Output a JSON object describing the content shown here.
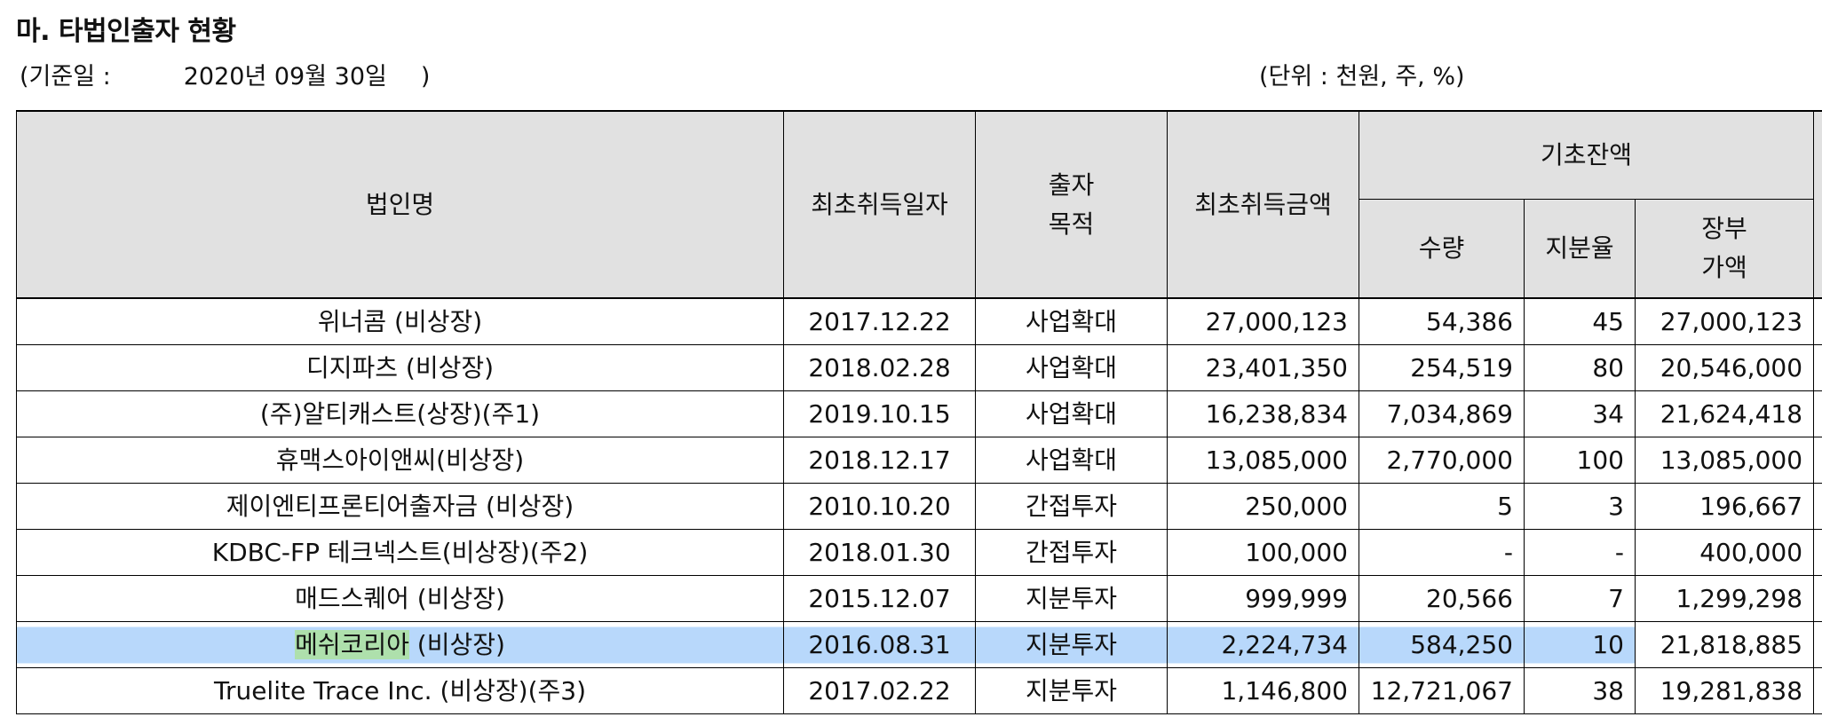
{
  "section_title": "마. 타법인출자 현황",
  "basis_label": "(기준일 :",
  "basis_date": "2020년 09월 30일",
  "basis_close": ")",
  "unit_label": "(단위 : 천원, 주, %)",
  "headers": {
    "corp_name": "법인명",
    "first_acq_date": "최초취득일자",
    "invest_purpose_1": "출자",
    "invest_purpose_2": "목적",
    "first_acq_amount": "최초취득금액",
    "opening_balance": "기초잔액",
    "quantity": "수량",
    "share_ratio": "지분율",
    "book_value_1": "장부",
    "book_value_2": "가액"
  },
  "rows": [
    {
      "name": "위너콤 (비상장)",
      "date": "2017.12.22",
      "purpose": "사업확대",
      "amount": "27,000,123",
      "qty": "54,386",
      "ratio": "45",
      "book": "27,000,123"
    },
    {
      "name": "디지파츠 (비상장)",
      "date": "2018.02.28",
      "purpose": "사업확대",
      "amount": "23,401,350",
      "qty": "254,519",
      "ratio": "80",
      "book": "20,546,000"
    },
    {
      "name": "(주)알티캐스트(상장)(주1)",
      "date": "2019.10.15",
      "purpose": "사업확대",
      "amount": "16,238,834",
      "qty": "7,034,869",
      "ratio": "34",
      "book": "21,624,418"
    },
    {
      "name": "휴맥스아이앤씨(비상장)",
      "date": "2018.12.17",
      "purpose": "사업확대",
      "amount": "13,085,000",
      "qty": "2,770,000",
      "ratio": "100",
      "book": "13,085,000"
    },
    {
      "name": "제이엔티프론티어출자금 (비상장)",
      "date": "2010.10.20",
      "purpose": "간접투자",
      "amount": "250,000",
      "qty": "5",
      "ratio": "3",
      "book": "196,667"
    },
    {
      "name": "KDBC-FP 테크넥스트(비상장)(주2)",
      "date": "2018.01.30",
      "purpose": "간접투자",
      "amount": "100,000",
      "qty": "-",
      "ratio": "-",
      "book": "400,000"
    },
    {
      "name": "매드스퀘어 (비상장)",
      "date": "2015.12.07",
      "purpose": "지분투자",
      "amount": "999,999",
      "qty": "20,566",
      "ratio": "7",
      "book": "1,299,298"
    },
    {
      "name_a": "메쉬코리아",
      "name_b": " (비상장)",
      "date": "2016.08.31",
      "purpose": "지분투자",
      "amount": "2,224,734",
      "qty": "584,250",
      "ratio": "10",
      "book": "21,818,885"
    },
    {
      "name": "Truelite Trace Inc. (비상장)(주3)",
      "date": "2017.02.22",
      "purpose": "지분투자",
      "amount": "1,146,800",
      "qty": "12,721,067",
      "ratio": "38",
      "book": "19,281,838"
    }
  ]
}
